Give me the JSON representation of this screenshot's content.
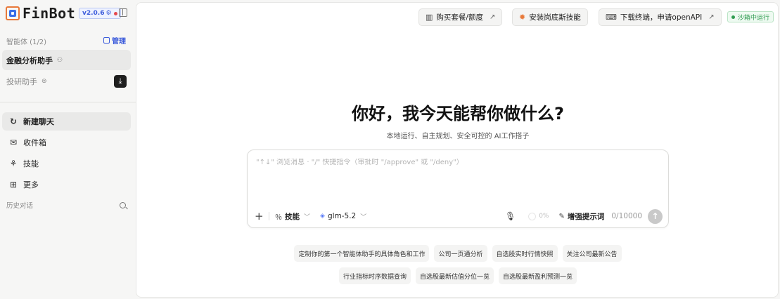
{
  "app": {
    "name": "FinBot",
    "version": "v2.0.6",
    "brand_color": "#3a6fe8",
    "accent_color": "#3b5bdb"
  },
  "sidebar": {
    "agents_label": "智能体 (1/2)",
    "manage_label": "管理",
    "agents": [
      {
        "label": "金融分析助手",
        "icon": "person-icon",
        "active": true
      },
      {
        "label": "投研助手",
        "icon": "robot-icon",
        "active": false
      }
    ],
    "nav": [
      {
        "label": "新建聊天",
        "icon": "refresh-chat-icon",
        "active": true
      },
      {
        "label": "收件箱",
        "icon": "mail-icon",
        "active": false
      },
      {
        "label": "技能",
        "icon": "skill-icon",
        "active": false
      },
      {
        "label": "更多",
        "icon": "grid-icon",
        "active": false
      }
    ],
    "history_label": "历史对话"
  },
  "topbar": {
    "buy_plan": "购买套餐/额度",
    "install_skills": "安装岗底斯技能",
    "download_terminal": "下载终端，申请openAPI",
    "sandbox_status": "沙箱中运行",
    "sandbox_color": "#2e9b4f"
  },
  "hero": {
    "title": "你好，我今天能帮你做什么?",
    "subtitle": "本地运行、自主规划、安全可控的 AI工作搭子"
  },
  "composer": {
    "placeholder": "\"↑↓\" 浏览消息 · \"/\" 快捷指令（审批时 \"/approve\" 或 \"/deny\"）",
    "value": "",
    "skills_label": "技能",
    "model": "glm-5.2",
    "progress": "0%",
    "enhance_label": "增强提示词",
    "char_count": "0/10000"
  },
  "suggestions": {
    "row1": [
      "定制你的第一个智能体助手的具体角色和工作",
      "公司一页通分析",
      "自选股实时行情快照",
      "关注公司最新公告"
    ],
    "row2": [
      "行业指标时序数据查询",
      "自选股最新估值分位一览",
      "自选股最新盈利预测一览"
    ]
  }
}
